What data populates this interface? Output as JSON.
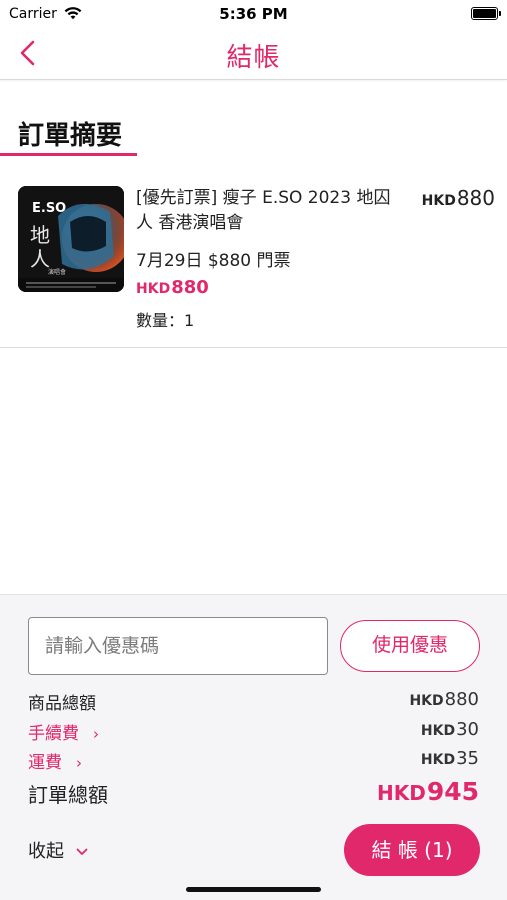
{
  "status_bar": {
    "carrier": "Carrier",
    "time": "5:36 PM",
    "wifi_icon": "wifi-icon",
    "battery_icon": "battery-icon"
  },
  "nav": {
    "title": "結帳",
    "back_icon": "chevron-left-icon"
  },
  "order_summary": {
    "title": "訂單摘要",
    "items": [
      {
        "name": "[優先訂票] 瘦子 E.SO 2023 地囚人 香港演唱會",
        "variant": "7月29日 $880 門票",
        "unit_price_currency": "HKD",
        "unit_price_value": "880",
        "line_price_currency": "HKD",
        "line_price_value": "880",
        "quantity_label": "數量：1",
        "poster_text": "E.SO",
        "poster_subtitle": "演唱會"
      }
    ]
  },
  "coupon": {
    "placeholder": "請輸入優惠碼",
    "button_label": "使用優惠"
  },
  "summary": {
    "subtotal": {
      "label": "商品總額",
      "currency": "HKD",
      "value": "880"
    },
    "fee": {
      "label": "手續費",
      "chevron": "›",
      "currency": "HKD",
      "value": "30"
    },
    "shipping": {
      "label": "運費",
      "chevron": "›",
      "currency": "HKD",
      "value": "35"
    },
    "total": {
      "label": "訂單總額",
      "currency": "HKD",
      "value": "945"
    }
  },
  "footer": {
    "collapse_label": "收起",
    "collapse_chevron": "⌄",
    "checkout_label": "結 帳 (1)"
  },
  "colors": {
    "accent": "#e0286a",
    "panel_bg": "#f5f5f7"
  }
}
